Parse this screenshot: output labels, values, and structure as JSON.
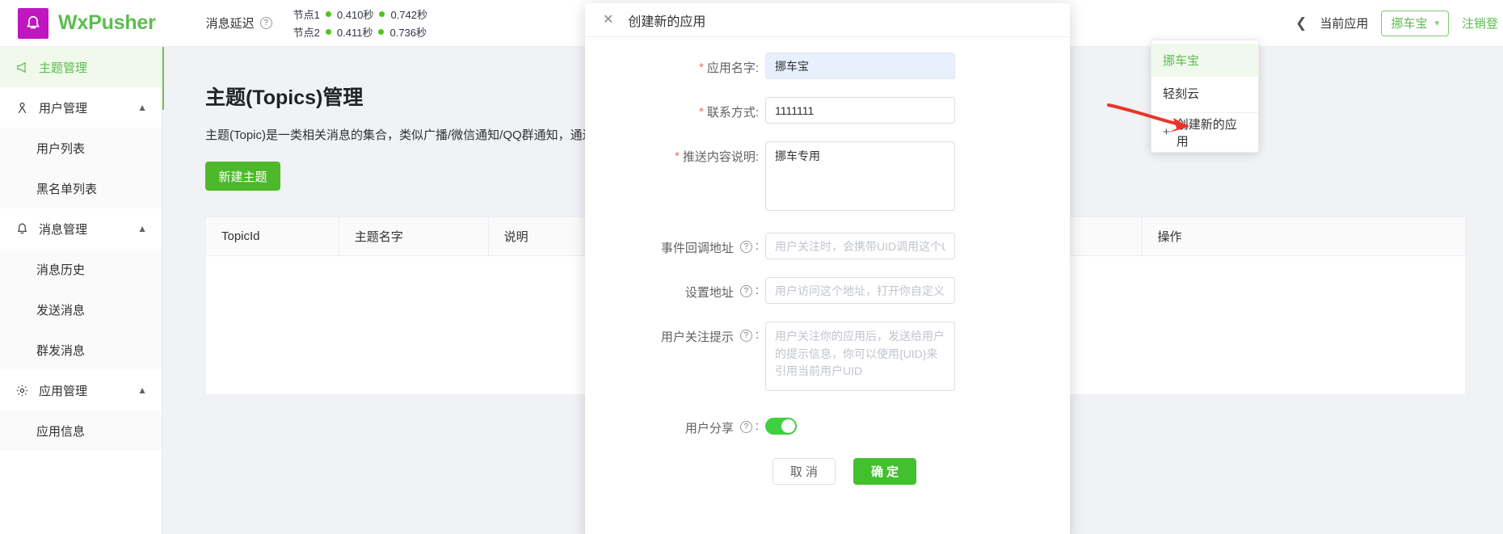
{
  "topbar": {
    "brand_name": "WxPusher",
    "logo_icon": "bell-icon",
    "delay_label": "消息延迟",
    "delay_help_icon": "question-icon",
    "delay_rows": [
      {
        "node": "节点1",
        "value1": "0.410秒",
        "value2": "0.742秒"
      },
      {
        "node": "节点2",
        "value1": "0.411秒",
        "value2": "0.736秒"
      }
    ],
    "collapse_icon": "chevron-left-icon",
    "current_app_label": "当前应用",
    "current_app_value": "挪车宝",
    "chevron_icon": "chevron-down-icon",
    "logout_label": "注销登"
  },
  "app_dropdown": {
    "items": [
      {
        "label": "挪车宝",
        "active": true
      },
      {
        "label": "轻刻云",
        "active": false
      }
    ],
    "create_label": "创建新的应用",
    "create_icon": "plus-icon"
  },
  "sidebar": {
    "items": [
      {
        "label": "主题管理",
        "icon": "megaphone-icon",
        "active": true,
        "expandable": false
      },
      {
        "label": "用户管理",
        "icon": "user-icon",
        "active": false,
        "expandable": true,
        "children": [
          {
            "label": "用户列表"
          },
          {
            "label": "黑名单列表"
          }
        ]
      },
      {
        "label": "消息管理",
        "icon": "bell-icon",
        "active": false,
        "expandable": true,
        "children": [
          {
            "label": "消息历史"
          },
          {
            "label": "发送消息"
          },
          {
            "label": "群发消息"
          }
        ]
      },
      {
        "label": "应用管理",
        "icon": "gear-icon",
        "active": false,
        "expandable": true,
        "children": [
          {
            "label": "应用信息"
          }
        ]
      }
    ],
    "expand_arrow": "chevron-up-icon"
  },
  "main": {
    "title": "主题(Topics)管理",
    "subtitle": "主题(Topic)是一类相关消息的集合，类似广播/微信通知/QQ群通知，通过",
    "new_topic_button": "新建主题",
    "table": {
      "columns": [
        "TopicId",
        "主题名字",
        "说明",
        "操作"
      ],
      "rows": []
    }
  },
  "modal": {
    "title": "创建新的应用",
    "close_icon": "close-icon",
    "fields": [
      {
        "label": "应用名字:",
        "required": true,
        "value": "挪车宝",
        "placeholder": "",
        "help": false,
        "type": "input",
        "autofill": true
      },
      {
        "label": "联系方式:",
        "required": true,
        "value": "1111111",
        "placeholder": "",
        "help": false,
        "type": "input",
        "autofill": false
      },
      {
        "label": "推送内容说明:",
        "required": true,
        "value": "挪车专用",
        "placeholder": "",
        "help": false,
        "type": "textarea"
      },
      {
        "label": "事件回调地址",
        "required": false,
        "value": "",
        "placeholder": "用户关注时，会携带UID调用这个URl",
        "help": true,
        "type": "input",
        "autofill": false
      },
      {
        "label": "设置地址",
        "required": false,
        "value": "",
        "placeholder": "用户访问这个地址，打开你自定义的要...",
        "help": true,
        "type": "input",
        "autofill": false
      },
      {
        "label": "用户关注提示",
        "required": false,
        "value": "",
        "placeholder": "用户关注你的应用后，发送给用户的提示信息，你可以使用{UID}来引用当前用户UID",
        "help": true,
        "type": "textarea"
      }
    ],
    "share_label": "用户分享",
    "share_help_icon": "question-icon",
    "share_enabled": true,
    "cancel_label": "取 消",
    "confirm_label": "确 定"
  },
  "colors": {
    "brand_green": "#5bbd4e",
    "logo_magenta": "#c016c0",
    "primary_button": "#42c02e",
    "new_topic_button": "#4eb82b",
    "status_dot": "#52c41a",
    "required_star": "#f56c6c",
    "arrow_red": "#e8352a",
    "autofill_bg": "#e8f0fe"
  }
}
